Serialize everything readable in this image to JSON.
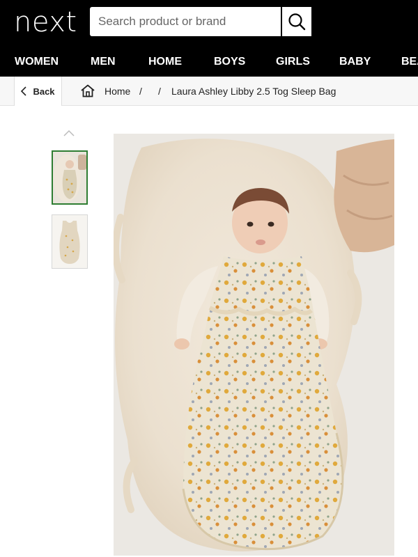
{
  "header": {
    "logo": "next",
    "search": {
      "placeholder": "Search product or brand",
      "value": ""
    }
  },
  "nav": {
    "items": [
      "WOMEN",
      "MEN",
      "HOME",
      "BOYS",
      "GIRLS",
      "BABY",
      "BEA"
    ]
  },
  "breadcrumb": {
    "back_label": "Back",
    "home_label": "Home",
    "separator": "/",
    "current": "Laura Ashley Libby 2.5 Tog Sleep Bag"
  },
  "colors": {
    "header_bg": "#000000",
    "selected_thumb_border": "#2e7d32",
    "breadcrumb_bg": "#f7f7f7"
  },
  "icons": {
    "search": "search-icon",
    "back": "chevron-left-icon",
    "home": "home-icon",
    "thumbs_up": "chevron-up-icon"
  }
}
